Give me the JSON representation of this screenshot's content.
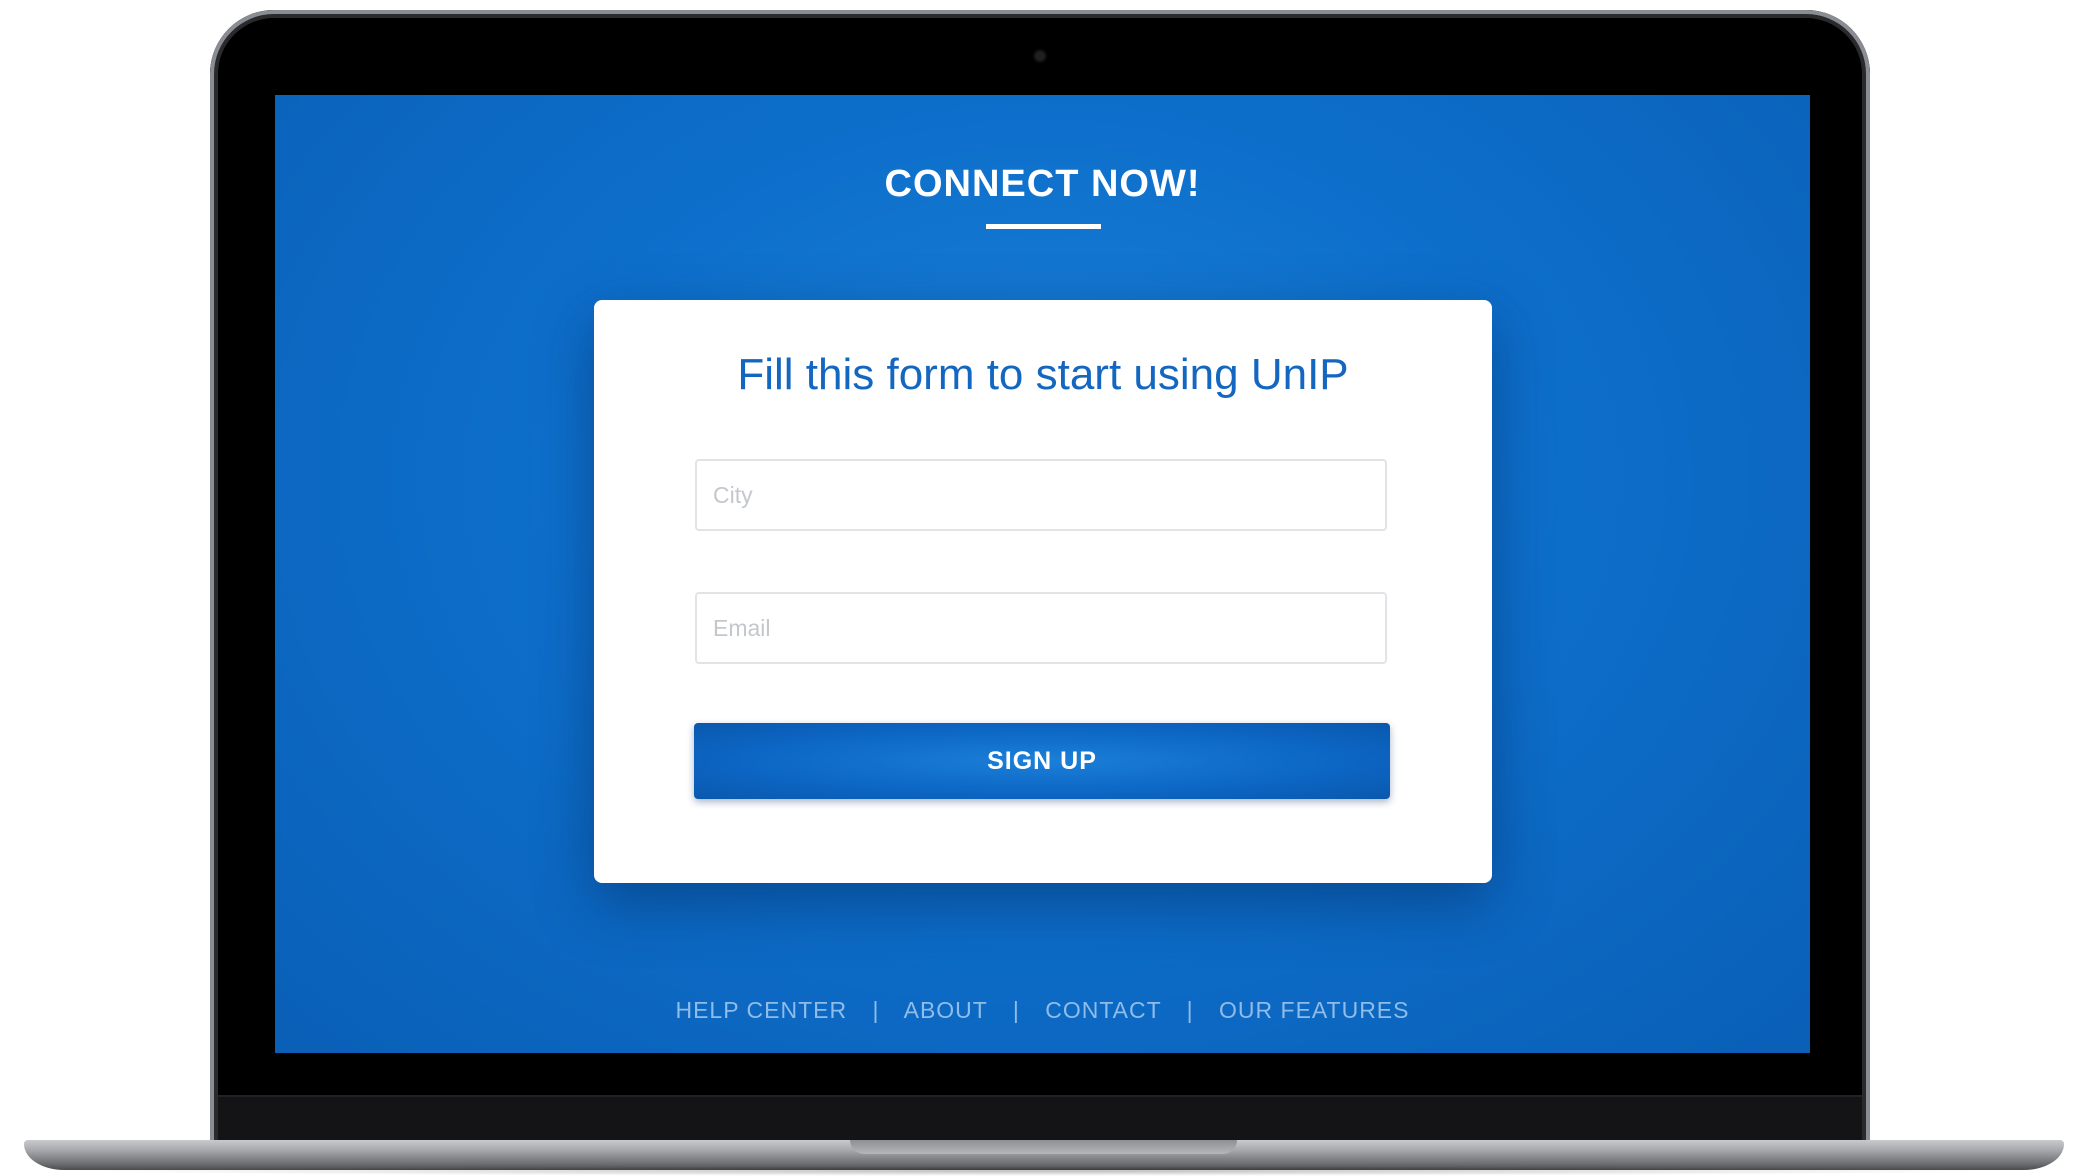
{
  "page": {
    "heading": "CONNECT NOW!",
    "card": {
      "title": "Fill this form to start using UnIP",
      "city_placeholder": "City",
      "city_value": "",
      "email_placeholder": "Email",
      "email_value": "",
      "signup_label": "SIGN UP"
    },
    "footer": {
      "links": [
        "HELP CENTER",
        "ABOUT",
        "CONTACT",
        "OUR FEATURES"
      ],
      "separator": "|"
    }
  },
  "colors": {
    "screen_background": "#0d6fcb",
    "card_title": "#1467c0",
    "button": "#0c66c4",
    "footer_text": "#8fbce8",
    "laptop_bezel": "#000000",
    "laptop_base": "#a5a7ab"
  },
  "device": {
    "type": "laptop",
    "icons": [
      "camera-icon"
    ]
  }
}
